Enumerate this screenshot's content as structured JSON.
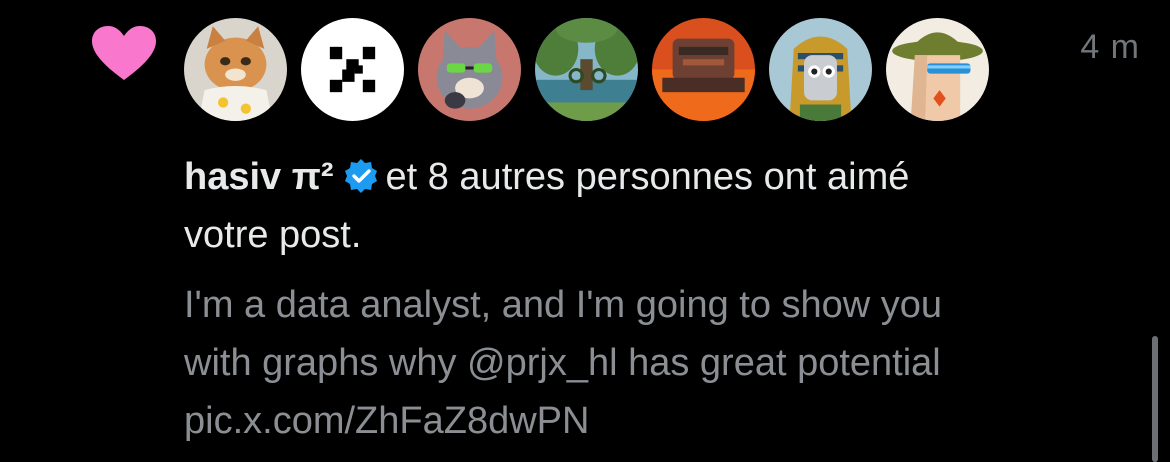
{
  "notification": {
    "type_icon": "heart-icon",
    "time": "4 m",
    "avatars": [
      {
        "name": "cat-avatar"
      },
      {
        "name": "glitch-logo-avatar"
      },
      {
        "name": "cartoon-cat-avatar"
      },
      {
        "name": "landscape-art-avatar"
      },
      {
        "name": "red-armor-avatar"
      },
      {
        "name": "pharaoh-robot-avatar"
      },
      {
        "name": "woman-hat-avatar"
      }
    ],
    "actor_name": "hasiv π²",
    "actor_verified": true,
    "action_text": "et 8 autres personnes ont aimé",
    "action_text_line2": "votre post.",
    "post_lines": [
      "I'm a data analyst, and I'm going to show you",
      "with graphs why @prjx_hl  has great potential",
      "pic.x.com/ZhFaZ8dwPN"
    ]
  },
  "colors": {
    "background": "#000000",
    "heart": "#f977cd",
    "verified": "#1d9bf0",
    "primary_text": "#e7e9ea",
    "secondary_text": "#8b8f94"
  }
}
